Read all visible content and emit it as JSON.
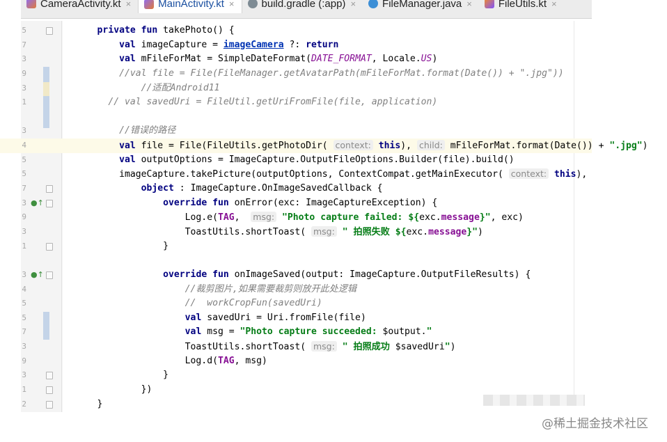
{
  "tabs": [
    {
      "label": "CameraActivity.kt",
      "icon": "kotlin-file-icon",
      "active": false
    },
    {
      "label": "MainActivity.kt",
      "icon": "kotlin-file-icon",
      "active": true
    },
    {
      "label": "build.gradle (:app)",
      "icon": "gradle-file-icon",
      "active": false
    },
    {
      "label": "FileManager.java",
      "icon": "java-class-icon",
      "active": false
    },
    {
      "label": "FileUtils.kt",
      "icon": "kotlin-file-icon",
      "active": false
    }
  ],
  "line_numbers": [
    "5",
    "7",
    "3",
    "9",
    "3",
    "1",
    "",
    "3",
    "4",
    "5",
    "5",
    "7",
    "3",
    "9",
    "3",
    "1",
    "",
    "3",
    "4",
    "5",
    "5",
    "7",
    "3",
    "9",
    "3",
    "1",
    "2",
    "3"
  ],
  "code_lines": [
    [
      {
        "t": "    "
      },
      {
        "t": "private fun",
        "c": "kw"
      },
      {
        "t": " takePhoto() {"
      }
    ],
    [
      {
        "t": "        "
      },
      {
        "t": "val",
        "c": "kw"
      },
      {
        "t": " imageCapture = "
      },
      {
        "t": "imageCamera",
        "c": "lnk"
      },
      {
        "t": " ?: "
      },
      {
        "t": "return",
        "c": "kw"
      }
    ],
    [
      {
        "t": "        "
      },
      {
        "t": "val",
        "c": "kw"
      },
      {
        "t": " mFileForMat = SimpleDateFormat("
      },
      {
        "t": "DATE_FORMAT",
        "c": "cst"
      },
      {
        "t": ", Locale."
      },
      {
        "t": "US",
        "c": "cst"
      },
      {
        "t": ")"
      }
    ],
    [
      {
        "t": "        "
      },
      {
        "t": "//val file = File(FileManager.getAvatarPath(mFileForMat.format(Date()) + \".jpg\"))",
        "c": "cm"
      }
    ],
    [
      {
        "t": "            "
      },
      {
        "t": "//适配Android11",
        "c": "cm"
      }
    ],
    [
      {
        "t": "      "
      },
      {
        "t": "// val savedUri = FileUtil.getUriFromFile(file, application)",
        "c": "cm"
      }
    ],
    [],
    [
      {
        "t": "        "
      },
      {
        "t": "//错误的路径",
        "c": "cm"
      }
    ],
    [
      {
        "t": "        "
      },
      {
        "t": "val",
        "c": "kw"
      },
      {
        "t": " file = File(FileUtils.getPhotoDir( "
      },
      {
        "t": "context:",
        "c": "hint"
      },
      {
        "t": " "
      },
      {
        "t": "this",
        "c": "kw"
      },
      {
        "t": "), "
      },
      {
        "t": "child:",
        "c": "hint"
      },
      {
        "t": " mFileForMat.format(Date()) + "
      },
      {
        "t": "\".jpg\"",
        "c": "str"
      },
      {
        "t": ")"
      }
    ],
    [
      {
        "t": "        "
      },
      {
        "t": "val",
        "c": "kw"
      },
      {
        "t": " outputOptions = ImageCapture.OutputFileOptions.Builder(file).build()"
      }
    ],
    [
      {
        "t": "        imageCapture.takePicture(outputOptions, ContextCompat.getMainExecutor( "
      },
      {
        "t": "context:",
        "c": "hint"
      },
      {
        "t": " "
      },
      {
        "t": "this",
        "c": "kw"
      },
      {
        "t": "),"
      }
    ],
    [
      {
        "t": "            "
      },
      {
        "t": "object",
        "c": "kw"
      },
      {
        "t": " : ImageCapture.OnImageSavedCallback {"
      }
    ],
    [
      {
        "t": "                "
      },
      {
        "t": "override fun",
        "c": "kw"
      },
      {
        "t": " onError(exc: ImageCaptureException) {"
      }
    ],
    [
      {
        "t": "                    Log.e("
      },
      {
        "t": "TAG",
        "c": "fld"
      },
      {
        "t": ",  "
      },
      {
        "t": "msg:",
        "c": "hint"
      },
      {
        "t": " "
      },
      {
        "t": "\"Photo capture failed: ${",
        "c": "str"
      },
      {
        "t": "exc."
      },
      {
        "t": "message",
        "c": "fld"
      },
      {
        "t": "}\"",
        "c": "str"
      },
      {
        "t": ", exc)"
      }
    ],
    [
      {
        "t": "                    ToastUtils.shortToast( "
      },
      {
        "t": "msg:",
        "c": "hint"
      },
      {
        "t": " "
      },
      {
        "t": "\" 拍照失败 ${",
        "c": "str"
      },
      {
        "t": "exc."
      },
      {
        "t": "message",
        "c": "fld"
      },
      {
        "t": "}\"",
        "c": "str"
      },
      {
        "t": ")"
      }
    ],
    [
      {
        "t": "                }"
      }
    ],
    [],
    [
      {
        "t": "                "
      },
      {
        "t": "override fun",
        "c": "kw"
      },
      {
        "t": " onImageSaved(output: ImageCapture.OutputFileResults) {"
      }
    ],
    [
      {
        "t": "                    "
      },
      {
        "t": "//裁剪图片,如果需要裁剪则放开此处逻辑",
        "c": "cm"
      }
    ],
    [
      {
        "t": "                    "
      },
      {
        "t": "//  workCropFun(savedUri)",
        "c": "cm"
      }
    ],
    [
      {
        "t": "                    "
      },
      {
        "t": "val",
        "c": "kw"
      },
      {
        "t": " savedUri = Uri.fromFile(file)"
      }
    ],
    [
      {
        "t": "                    "
      },
      {
        "t": "val",
        "c": "kw"
      },
      {
        "t": " msg = "
      },
      {
        "t": "\"Photo capture succeeded: ",
        "c": "str"
      },
      {
        "t": "$output."
      },
      {
        "t": "\"",
        "c": "str"
      }
    ],
    [
      {
        "t": "                    ToastUtils.shortToast( "
      },
      {
        "t": "msg:",
        "c": "hint"
      },
      {
        "t": " "
      },
      {
        "t": "\" 拍照成功 ",
        "c": "str"
      },
      {
        "t": "$savedUri"
      },
      {
        "t": "\"",
        "c": "str"
      },
      {
        "t": ")"
      }
    ],
    [
      {
        "t": "                    Log.d("
      },
      {
        "t": "TAG",
        "c": "fld"
      },
      {
        "t": ", msg)"
      }
    ],
    [
      {
        "t": "                }"
      }
    ],
    [
      {
        "t": "            })"
      }
    ],
    [
      {
        "t": "    }"
      }
    ]
  ],
  "current_line": 8,
  "gutter_marks": [
    {
      "line": 12,
      "glyph": "●↑",
      "icon": "override-method-icon"
    },
    {
      "line": 17,
      "glyph": "●↑",
      "icon": "override-method-icon"
    }
  ],
  "fold_lines": [
    0,
    11,
    12,
    15,
    17,
    24,
    25,
    26
  ],
  "watermark": "@稀土掘金技术社区",
  "colors": {
    "keyword": "#000080",
    "comment": "#808080",
    "string": "#067d17",
    "field": "#871094"
  }
}
